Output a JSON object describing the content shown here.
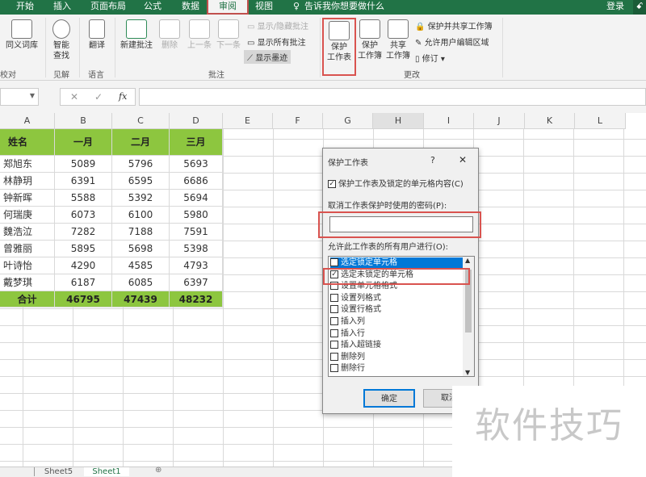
{
  "tabs": [
    "开始",
    "插入",
    "页面布局",
    "公式",
    "数据",
    "审阅",
    "视图"
  ],
  "tell_me": "告诉我你想要做什么",
  "login": "登录",
  "ribbon": {
    "thesaurus": "同义词库",
    "proofing": "校对",
    "smart_lookup": [
      "智能",
      "查找"
    ],
    "insights": "见解",
    "translate": "翻译",
    "language": "语言",
    "new_comment": "新建批注",
    "delete": "删除",
    "prev": "上一条",
    "next": "下一条",
    "show_hide_comment": "显示/隐藏批注",
    "show_all_comments": "显示所有批注",
    "show_ink": "显示墨迹",
    "comments": "批注",
    "protect_sheet": [
      "保护",
      "工作表"
    ],
    "protect_workbook": [
      "保护",
      "工作簿"
    ],
    "share_workbook": [
      "共享",
      "工作簿"
    ],
    "protect_share": "保护并共享工作簿",
    "allow_edit_ranges": "允许用户编辑区域",
    "track_changes": "修订",
    "changes": "更改"
  },
  "formula_bar": {
    "fx": "fx",
    "cancel": "✕",
    "enter": "✓"
  },
  "columns": [
    "A",
    "B",
    "C",
    "D",
    "E",
    "F",
    "G",
    "H",
    "I",
    "J",
    "K",
    "L"
  ],
  "table": {
    "headers": [
      "姓名",
      "一月",
      "二月",
      "三月"
    ],
    "rows": [
      [
        "郑旭东",
        "5089",
        "5796",
        "5693"
      ],
      [
        "林静玥",
        "6391",
        "6595",
        "6686"
      ],
      [
        "钟新晖",
        "5588",
        "5392",
        "5694"
      ],
      [
        "何瑞庚",
        "6073",
        "6100",
        "5980"
      ],
      [
        "魏浩泣",
        "7282",
        "7188",
        "7591"
      ],
      [
        "曾雅丽",
        "5895",
        "5698",
        "5398"
      ],
      [
        "叶诗怡",
        "4290",
        "4585",
        "4793"
      ],
      [
        "戴梦琪",
        "6187",
        "6085",
        "6397"
      ]
    ],
    "total": [
      "合计",
      "46795",
      "47439",
      "48232"
    ]
  },
  "dialog": {
    "title": "保护工作表",
    "help": "?",
    "close": "✕",
    "protect_check": "保护工作表及锁定的单元格内容(C)",
    "password_label": "取消工作表保护时使用的密码(P):",
    "password_value": "",
    "allow_label": "允许此工作表的所有用户进行(O):",
    "options": [
      {
        "label": "选定锁定单元格",
        "checked": false
      },
      {
        "label": "选定未锁定的单元格",
        "checked": true
      },
      {
        "label": "设置单元格格式",
        "checked": false
      },
      {
        "label": "设置列格式",
        "checked": false
      },
      {
        "label": "设置行格式",
        "checked": false
      },
      {
        "label": "插入列",
        "checked": false
      },
      {
        "label": "插入行",
        "checked": false
      },
      {
        "label": "插入超链接",
        "checked": false
      },
      {
        "label": "删除列",
        "checked": false
      },
      {
        "label": "删除行",
        "checked": false
      }
    ],
    "ok": "确定",
    "cancel": "取消"
  },
  "sheets": [
    "Sheet5",
    "Sheet1"
  ],
  "watermark": "软件技巧",
  "colors": {
    "excel_green": "#217346",
    "table_green": "#8dc63f",
    "highlight_red": "#d9534f",
    "selection_blue": "#0078d7"
  }
}
